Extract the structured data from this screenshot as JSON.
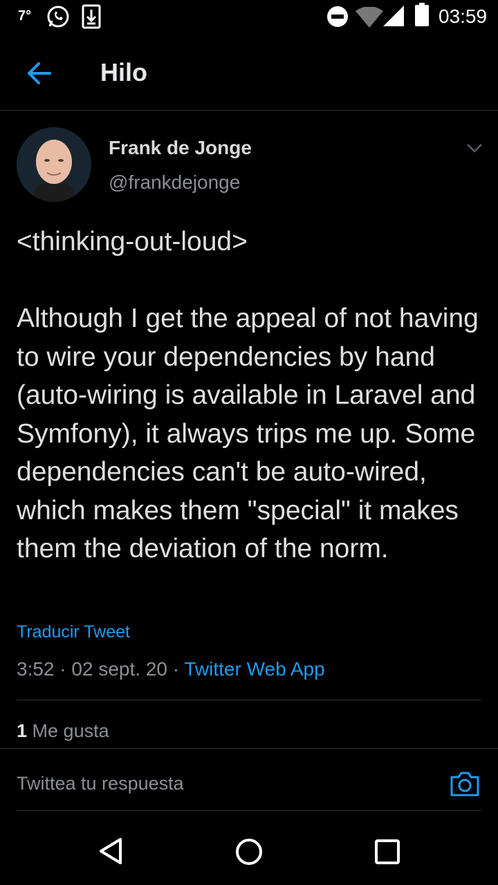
{
  "status_bar": {
    "temperature": "7°",
    "time": "03:59",
    "icons": [
      "whatsapp-icon",
      "download-icon",
      "do-not-disturb-icon",
      "wifi-icon",
      "signal-icon",
      "battery-icon"
    ]
  },
  "header": {
    "title": "Hilo",
    "back_icon": "arrow-left-icon"
  },
  "tweet": {
    "author_name": "Frank de Jonge",
    "author_handle": "@frankdejonge",
    "text": "<thinking-out-loud>\n\nAlthough I get the appeal of not having to wire your dependencies by hand (auto-wiring is available in Laravel and Symfony), it always trips me up. Some dependencies can't be auto-wired, which makes them \"special\" it makes them the deviation of the norm.",
    "translate_label": "Traducir Tweet",
    "time": "3:52",
    "date": "02 sept. 20",
    "separator": " · ",
    "source_app": "Twitter Web App",
    "likes_count": "1",
    "likes_label": "Me gusta"
  },
  "reply": {
    "placeholder": "Twittea tu respuesta"
  },
  "colors": {
    "accent": "#1d9bf0",
    "background": "#000000",
    "secondary_text": "#8b8f94"
  }
}
